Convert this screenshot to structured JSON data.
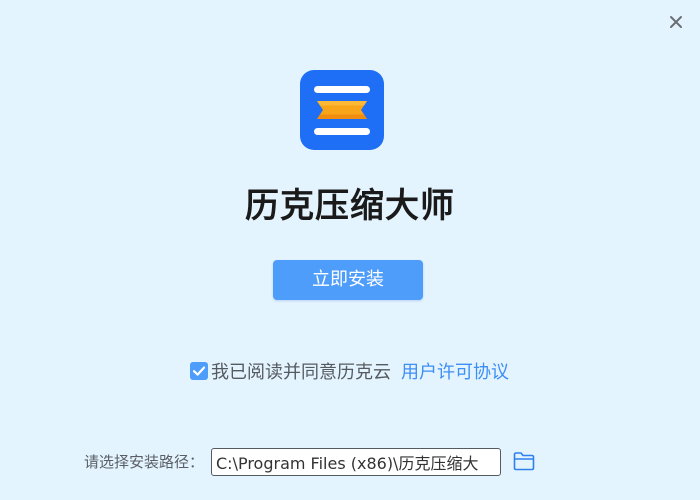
{
  "window": {
    "close_icon": "close-icon",
    "background_color": "#e4f4fe"
  },
  "app": {
    "logo_icon": "compressor-logo-icon",
    "title": "历克压缩大师"
  },
  "install": {
    "button_label": "立即安装",
    "button_color": "#4f9dfa"
  },
  "agreement": {
    "checked": true,
    "text": "我已阅读并同意历克云",
    "link_label": "用户许可协议",
    "link_color": "#3d8ef5"
  },
  "install_path": {
    "label": "请选择安装路径：",
    "value": "C:\\Program Files (x86)\\历克压缩大",
    "browse_icon": "folder-icon"
  }
}
